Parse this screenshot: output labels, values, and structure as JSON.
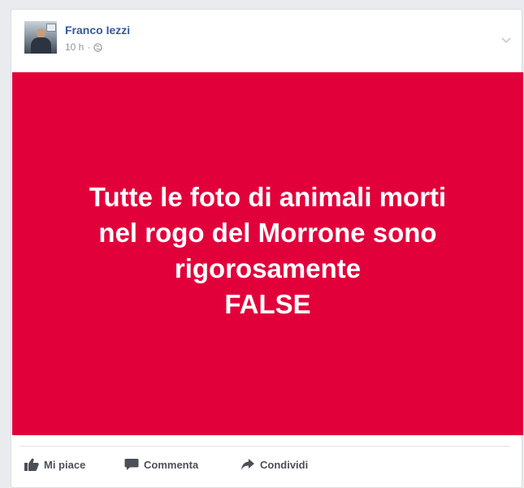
{
  "post": {
    "author": "Franco Iezzi",
    "time": "10 h",
    "separator": "·",
    "privacy_icon": "globe-icon",
    "options_icon": "chevron-down-icon"
  },
  "banner": {
    "lines": [
      "Tutte le foto di animali morti",
      "nel rogo del Morrone sono",
      "rigorosamente",
      "FALSE"
    ],
    "background": "#e2003b",
    "text_color": "#ffffff"
  },
  "actions": {
    "like": {
      "label": "Mi piace",
      "icon": "thumbs-up-icon"
    },
    "comment": {
      "label": "Commenta",
      "icon": "comment-icon"
    },
    "share": {
      "label": "Condividi",
      "icon": "share-arrow-icon"
    }
  },
  "colors": {
    "accent": "#365899",
    "muted": "#90949c",
    "background": "#e9ebee"
  }
}
